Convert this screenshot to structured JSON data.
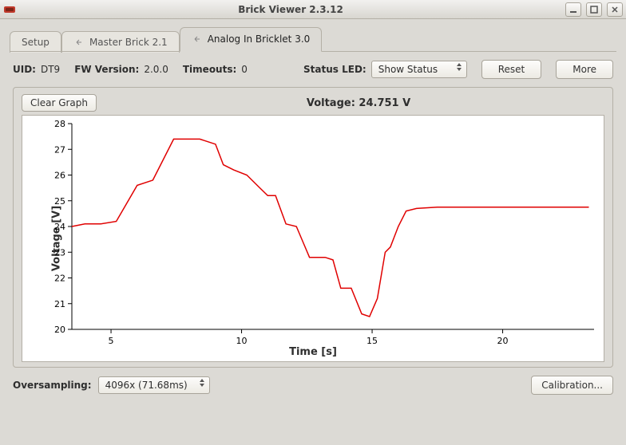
{
  "window": {
    "title": "Brick Viewer 2.3.12",
    "min_tooltip": "−",
    "close_tooltip": "×"
  },
  "tabs": [
    {
      "label": "Setup",
      "has_close": false
    },
    {
      "label": "Master Brick 2.1",
      "has_close": true
    },
    {
      "label": "Analog In Bricklet 3.0",
      "has_close": true,
      "active": true
    }
  ],
  "info": {
    "uid_label": "UID:",
    "uid_value": "DT9",
    "fw_label": "FW Version:",
    "fw_value": "2.0.0",
    "timeouts_label": "Timeouts:",
    "timeouts_value": "0",
    "statusled_label": "Status LED:",
    "statusled_value": "Show Status",
    "reset_label": "Reset",
    "more_label": "More"
  },
  "graph": {
    "clear_label": "Clear Graph",
    "readout_label": "Voltage: 24.751 V",
    "ylabel": "Voltage [V]",
    "xlabel": "Time [s]"
  },
  "bottom": {
    "oversampling_label": "Oversampling:",
    "oversampling_value": "4096x (71.68ms)",
    "calibration_label": "Calibration..."
  },
  "chart_data": {
    "type": "line",
    "title": "",
    "xlabel": "Time [s]",
    "ylabel": "Voltage [V]",
    "xlim": [
      3.5,
      23.5
    ],
    "ylim": [
      20,
      28
    ],
    "x_ticks": [
      5,
      10,
      15,
      20
    ],
    "y_ticks": [
      20,
      21,
      22,
      23,
      24,
      25,
      26,
      27,
      28
    ],
    "series": [
      {
        "name": "Voltage",
        "color": "#e00000",
        "x": [
          3.5,
          4.0,
          4.6,
          5.2,
          5.6,
          6.0,
          6.6,
          7.4,
          8.4,
          9.0,
          9.3,
          9.7,
          10.2,
          10.7,
          11.0,
          11.3,
          11.7,
          12.1,
          12.6,
          13.2,
          13.5,
          13.8,
          14.2,
          14.6,
          14.9,
          15.2,
          15.5,
          15.7,
          16.0,
          16.3,
          16.7,
          17.5,
          23.3
        ],
        "values": [
          24.0,
          24.1,
          24.1,
          24.2,
          24.9,
          25.6,
          25.8,
          27.4,
          27.4,
          27.2,
          26.4,
          26.2,
          26.0,
          25.5,
          25.2,
          25.2,
          24.1,
          24.0,
          22.8,
          22.8,
          22.7,
          21.6,
          21.6,
          20.6,
          20.5,
          21.2,
          23.0,
          23.2,
          24.0,
          24.6,
          24.7,
          24.75,
          24.75
        ]
      }
    ]
  }
}
